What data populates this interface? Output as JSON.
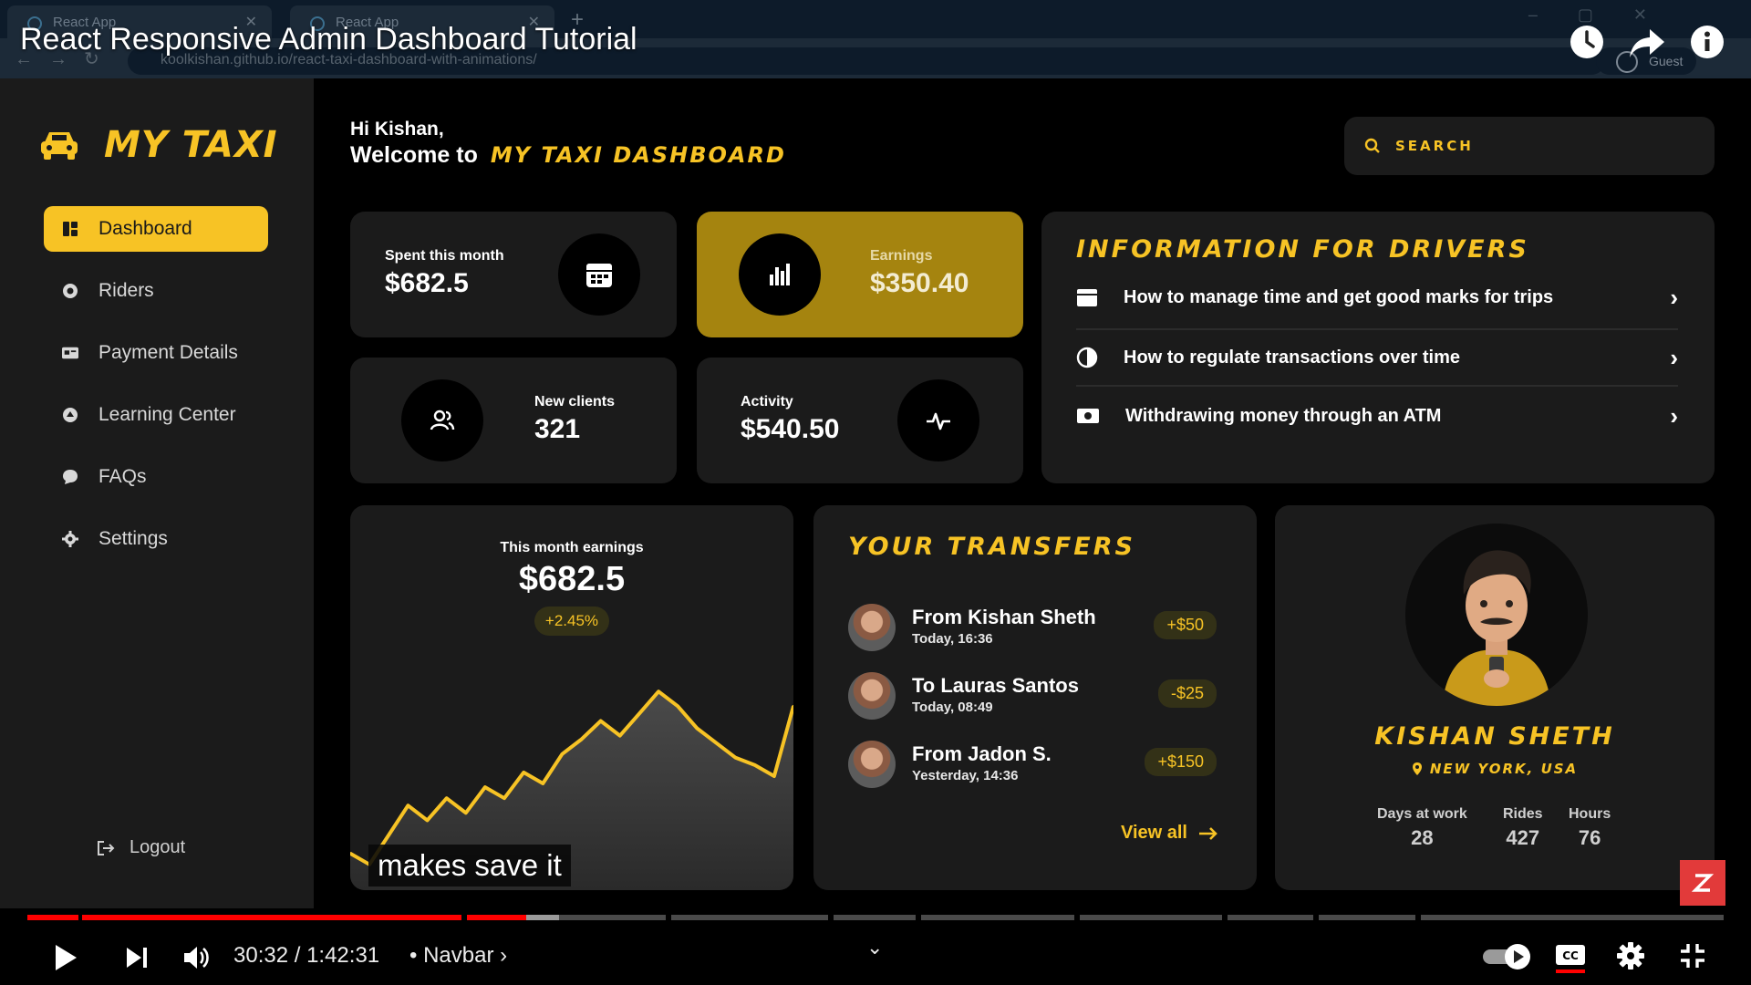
{
  "browser": {
    "tabs": [
      {
        "title": "React App"
      },
      {
        "title": "React App"
      }
    ],
    "url": "koolkishan.github.io/react-taxi-dashboard-with-animations/",
    "profile": "Guest"
  },
  "video": {
    "title": "React Responsive Admin Dashboard Tutorial",
    "subtitle": "makes save it",
    "current_time": "30:32",
    "duration": "1:42:31",
    "time_display": "30:32 / 1:42:31",
    "chapter": "• Navbar ›",
    "progress_fraction": 0.294
  },
  "app": {
    "logo": "MY TAXI",
    "nav": [
      {
        "label": "Dashboard",
        "icon": "dashboard-icon",
        "active": true
      },
      {
        "label": "Riders",
        "icon": "riders-icon",
        "active": false
      },
      {
        "label": "Payment Details",
        "icon": "payment-icon",
        "active": false
      },
      {
        "label": "Learning Center",
        "icon": "learning-icon",
        "active": false
      },
      {
        "label": "FAQs",
        "icon": "faq-icon",
        "active": false
      },
      {
        "label": "Settings",
        "icon": "gear-icon",
        "active": false
      }
    ],
    "logout": "Logout",
    "greeting": "Hi Kishan,",
    "welcome": "Welcome to",
    "welcome_brand": "MY TAXI DASHBOARD",
    "search_placeholder": "SEARCH",
    "colors": {
      "accent": "#f7c325",
      "card": "#1b1b1b",
      "sidebar": "#1b1b1b",
      "earnings_card": "#a5840f"
    }
  },
  "stats": {
    "spent": {
      "label": "Spent this month",
      "value": "$682.5"
    },
    "earnings": {
      "label": "Earnings",
      "value": "$350.40"
    },
    "new_clients": {
      "label": "New clients",
      "value": "321"
    },
    "activity": {
      "label": "Activity",
      "value": "$540.50"
    }
  },
  "info": {
    "title": "INFORMATION FOR DRIVERS",
    "items": [
      {
        "text": "How to manage time and get good marks for trips",
        "icon": "calendar-icon"
      },
      {
        "text": "How to regulate transactions over time",
        "icon": "clock-icon"
      },
      {
        "text": "Withdrawing money through an ATM",
        "icon": "cash-icon"
      }
    ]
  },
  "earnings_chart": {
    "label": "This month earnings",
    "value": "$682.5",
    "change": "+2.45%"
  },
  "chart_data": {
    "type": "area",
    "x": [
      0,
      1,
      2,
      3,
      4,
      5,
      6,
      7,
      8,
      9,
      10,
      11,
      12,
      13,
      14,
      15,
      16,
      17,
      18,
      19,
      20,
      21,
      22,
      23
    ],
    "values": [
      20,
      14,
      30,
      46,
      38,
      50,
      42,
      56,
      50,
      64,
      58,
      74,
      82,
      92,
      84,
      96,
      108,
      100,
      88,
      80,
      72,
      68,
      62,
      100
    ],
    "title": "",
    "xlabel": "",
    "ylabel": "",
    "ylim": [
      0,
      120
    ],
    "grid": false,
    "color": "#f7c325"
  },
  "transfers": {
    "title": "YOUR TRANSFERS",
    "items": [
      {
        "name": "From Kishan Sheth",
        "time": "Today, 16:36",
        "amount": "+$50"
      },
      {
        "name": "To Lauras Santos",
        "time": "Today, 08:49",
        "amount": "-$25"
      },
      {
        "name": "From Jadon S.",
        "time": "Yesterday, 14:36",
        "amount": "+$150"
      }
    ],
    "view_all": "View all"
  },
  "profile": {
    "name": "KISHAN SHETH",
    "location": "NEW YORK, USA",
    "stats": [
      {
        "label": "Days at work",
        "value": "28"
      },
      {
        "label": "Rides",
        "value": "427"
      },
      {
        "label": "Hours",
        "value": "76"
      }
    ]
  }
}
